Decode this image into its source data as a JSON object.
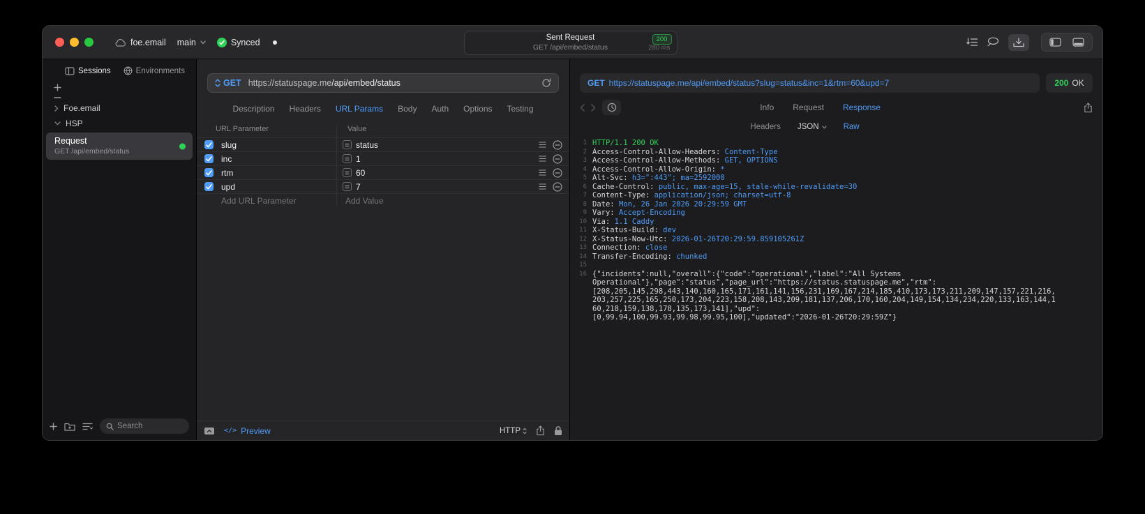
{
  "colors": {
    "accent": "#4f9cf8",
    "success": "#30d158"
  },
  "window": {
    "project": "foe.email",
    "branch": "main",
    "sync_status": "Synced",
    "title": "Sent Request",
    "title_badge": "200",
    "subtitle": "GET /api/embed/status",
    "subtitle_time": "280 ms"
  },
  "sidebar": {
    "tabs": [
      {
        "label": "Sessions",
        "selected": true
      },
      {
        "label": "Environments",
        "selected": false
      }
    ],
    "tree": [
      {
        "label": "Foe.email",
        "expanded": false
      },
      {
        "label": "HSP",
        "expanded": true
      }
    ],
    "selected_request": {
      "title": "Request",
      "subtitle": "GET /api/embed/status"
    },
    "search_placeholder": "Search"
  },
  "request": {
    "method": "GET",
    "url_domain": "https://statuspage.me",
    "url_path": "/api/embed/status",
    "tabs": [
      "Description",
      "Headers",
      "URL Params",
      "Body",
      "Auth",
      "Options",
      "Testing"
    ],
    "selected_tab": "URL Params",
    "params": {
      "col_name": "URL Parameter",
      "col_value": "Value",
      "rows": [
        {
          "name": "slug",
          "value": "status",
          "checked": true
        },
        {
          "name": "inc",
          "value": "1",
          "checked": true
        },
        {
          "name": "rtm",
          "value": "60",
          "checked": true
        },
        {
          "name": "upd",
          "value": "7",
          "checked": true
        }
      ],
      "add_name_placeholder": "Add URL Parameter",
      "add_value_placeholder": "Add Value"
    },
    "footer": {
      "preview_icon": "</>",
      "preview_label": "Preview",
      "http_label": "HTTP"
    }
  },
  "response": {
    "request_line": {
      "method": "GET",
      "url": "https://statuspage.me/api/embed/status?slug=status&inc=1&rtm=60&upd=7"
    },
    "status_code": "200",
    "status_text": "OK",
    "tabs": [
      "Info",
      "Request",
      "Response"
    ],
    "selected_tab": "Response",
    "subtabs": [
      "Headers",
      "JSON",
      "Raw"
    ],
    "selected_subtab": "Raw",
    "lines": [
      {
        "n": "1",
        "s": [
          {
            "t": "HTTP/1.1 200 OK",
            "c": "g"
          }
        ]
      },
      {
        "n": "2",
        "s": [
          {
            "t": "Access-Control-Allow-Headers: ",
            "c": "p"
          },
          {
            "t": "Content-Type",
            "c": "b"
          }
        ]
      },
      {
        "n": "3",
        "s": [
          {
            "t": "Access-Control-Allow-Methods: ",
            "c": "p"
          },
          {
            "t": "GET, OPTIONS",
            "c": "b"
          }
        ]
      },
      {
        "n": "4",
        "s": [
          {
            "t": "Access-Control-Allow-Origin: ",
            "c": "p"
          },
          {
            "t": "*",
            "c": "b"
          }
        ]
      },
      {
        "n": "5",
        "s": [
          {
            "t": "Alt-Svc: ",
            "c": "p"
          },
          {
            "t": "h3=\":443\"; ma=2592000",
            "c": "b"
          }
        ]
      },
      {
        "n": "6",
        "s": [
          {
            "t": "Cache-Control: ",
            "c": "p"
          },
          {
            "t": "public, max-age=15, stale-while-revalidate=30",
            "c": "b"
          }
        ]
      },
      {
        "n": "7",
        "s": [
          {
            "t": "Content-Type: ",
            "c": "p"
          },
          {
            "t": "application/json; charset=utf-8",
            "c": "b"
          }
        ]
      },
      {
        "n": "8",
        "s": [
          {
            "t": "Date: ",
            "c": "p"
          },
          {
            "t": "Mon, 26 Jan 2026 20:29:59 GMT",
            "c": "b"
          }
        ]
      },
      {
        "n": "9",
        "s": [
          {
            "t": "Vary: ",
            "c": "p"
          },
          {
            "t": "Accept-Encoding",
            "c": "b"
          }
        ]
      },
      {
        "n": "10",
        "s": [
          {
            "t": "Via: ",
            "c": "p"
          },
          {
            "t": "1.1 Caddy",
            "c": "b"
          }
        ]
      },
      {
        "n": "11",
        "s": [
          {
            "t": "X-Status-Build: ",
            "c": "p"
          },
          {
            "t": "dev",
            "c": "b"
          }
        ]
      },
      {
        "n": "12",
        "s": [
          {
            "t": "X-Status-Now-Utc: ",
            "c": "p"
          },
          {
            "t": "2026-01-26T20:29:59.859105261Z",
            "c": "b"
          }
        ]
      },
      {
        "n": "13",
        "s": [
          {
            "t": "Connection: ",
            "c": "p"
          },
          {
            "t": "close",
            "c": "b"
          }
        ]
      },
      {
        "n": "14",
        "s": [
          {
            "t": "Transfer-Encoding: ",
            "c": "p"
          },
          {
            "t": "chunked",
            "c": "b"
          }
        ]
      },
      {
        "n": "15",
        "s": []
      },
      {
        "n": "16",
        "s": [
          {
            "t": "{\"incidents\":null,\"overall\":{\"code\":\"operational\",\"label\":\"All Systems",
            "c": "p"
          }
        ]
      },
      {
        "n": "",
        "s": [
          {
            "t": "Operational\"},\"page\":\"status\",\"page_url\":\"https://status.statuspage.me\",\"rtm\":",
            "c": "p"
          }
        ]
      },
      {
        "n": "",
        "s": [
          {
            "t": "[208,205,145,298,443,140,160,165,171,161,141,156,231,169,167,214,185,410,173,173,211,209,147,157,221,216,",
            "c": "p"
          }
        ]
      },
      {
        "n": "",
        "s": [
          {
            "t": "203,257,225,165,250,173,204,223,158,208,143,209,181,137,206,170,160,204,149,154,134,234,220,133,163,144,1",
            "c": "p"
          }
        ]
      },
      {
        "n": "",
        "s": [
          {
            "t": "60,218,159,138,178,135,173,141],\"upd\":",
            "c": "p"
          }
        ]
      },
      {
        "n": "",
        "s": [
          {
            "t": "[0,99.94,100,99.93,99.98,99.95,100],\"updated\":\"2026-01-26T20:29:59Z\"}",
            "c": "p"
          }
        ]
      }
    ]
  }
}
